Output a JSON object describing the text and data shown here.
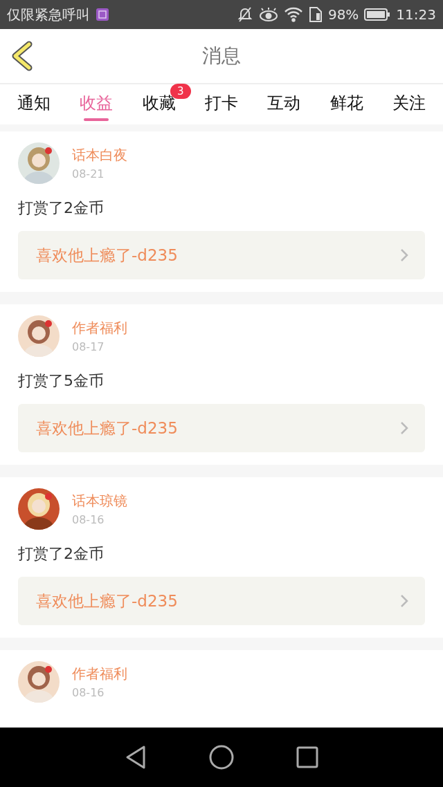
{
  "status_bar": {
    "carrier": "仅限紧急呼叫",
    "battery": "98%",
    "time": "11:23"
  },
  "header": {
    "title": "消息"
  },
  "tabs": [
    {
      "label": "通知",
      "selected": false
    },
    {
      "label": "收益",
      "selected": true
    },
    {
      "label": "收藏",
      "selected": false,
      "badge": "3"
    },
    {
      "label": "打卡",
      "selected": false
    },
    {
      "label": "互动",
      "selected": false
    },
    {
      "label": "鲜花",
      "selected": false
    },
    {
      "label": "关注",
      "selected": false
    }
  ],
  "messages": [
    {
      "name": "话本白夜",
      "date": "08-21",
      "text": "打赏了2金币",
      "link": "喜欢他上瘾了-d235"
    },
    {
      "name": "作者福利",
      "date": "08-17",
      "text": "打赏了5金币",
      "link": "喜欢他上瘾了-d235"
    },
    {
      "name": "话本琼镜",
      "date": "08-16",
      "text": "打赏了2金币",
      "link": "喜欢他上瘾了-d235"
    },
    {
      "name": "作者福利",
      "date": "08-16"
    }
  ]
}
